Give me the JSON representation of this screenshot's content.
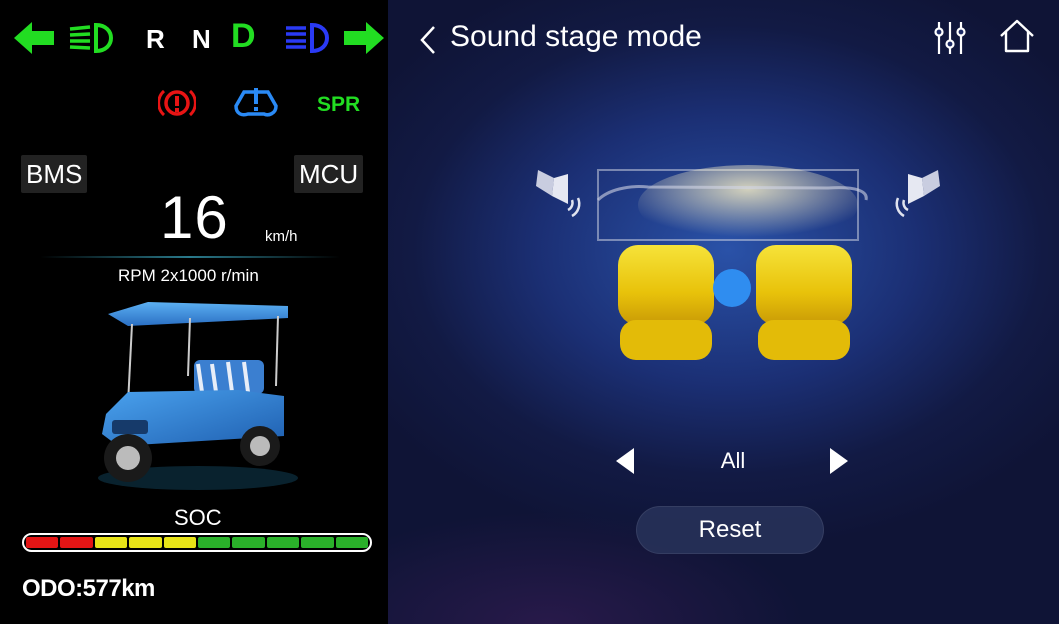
{
  "cluster": {
    "gears": {
      "r": "R",
      "n": "N",
      "d": "D"
    },
    "indicators": {
      "spr": "SPR"
    },
    "bms_label": "BMS",
    "mcu_label": "MCU",
    "speed": "16",
    "speed_unit": "km/h",
    "rpm": "RPM 2x1000 r/min",
    "soc_label": "SOC",
    "soc_segments": [
      "#e31515",
      "#e31515",
      "#e7e317",
      "#e7e317",
      "#e7e317",
      "#2ab02a",
      "#2ab02a",
      "#2ab02a",
      "#2ab02a",
      "#2ab02a"
    ],
    "odo": "ODO:577km"
  },
  "header": {
    "title": "Sound stage mode"
  },
  "stage": {
    "zone": "All",
    "reset_label": "Reset"
  },
  "colors": {
    "accent_green": "#22dd22",
    "headlight_blue": "#2a3af5",
    "warn_red": "#e81414",
    "seat_yellow": "#f2d00a",
    "focus_dot": "#2f8df0"
  },
  "icons": [
    "left-turn-icon",
    "low-beam-icon",
    "high-beam-icon",
    "right-turn-icon",
    "parking-brake-icon",
    "tire-warning-icon",
    "back-icon",
    "equalizer-icon",
    "home-icon",
    "speaker-left-icon",
    "speaker-right-icon",
    "arrow-left-icon",
    "arrow-right-icon"
  ]
}
